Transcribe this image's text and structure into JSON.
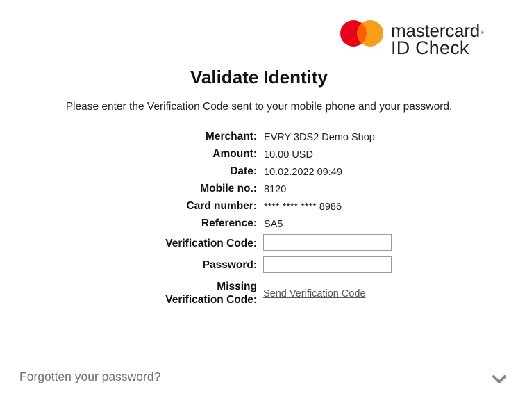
{
  "brand": {
    "wordmark": "mastercard",
    "registered": "®",
    "subtitle": "ID Check",
    "colors": {
      "left_circle": "#eb001b",
      "right_circle": "#f79e1b",
      "overlap": "#ff5f00"
    }
  },
  "page": {
    "title": "Validate Identity",
    "instructions": "Please enter the Verification Code sent to your mobile phone and your password."
  },
  "details": [
    {
      "label": "Merchant:",
      "value": "EVRY 3DS2 Demo Shop"
    },
    {
      "label": "Amount:",
      "value": "10.00 USD"
    },
    {
      "label": "Date:",
      "value": "10.02.2022 09:49"
    },
    {
      "label": "Mobile no.:",
      "value": "8120"
    },
    {
      "label": "Card number:",
      "value": "**** **** **** 8986"
    },
    {
      "label": "Reference:",
      "value": "SA5"
    }
  ],
  "form": {
    "verification_code": {
      "label": "Verification Code:",
      "value": ""
    },
    "password": {
      "label": "Password:",
      "value": ""
    },
    "missing": {
      "label_line1": "Missing",
      "label_line2": "Verification Code:",
      "link": "Send Verification Code"
    }
  },
  "footer": {
    "forgot_password": "Forgotten your password?",
    "expand_icon": "chevron-down-icon"
  }
}
